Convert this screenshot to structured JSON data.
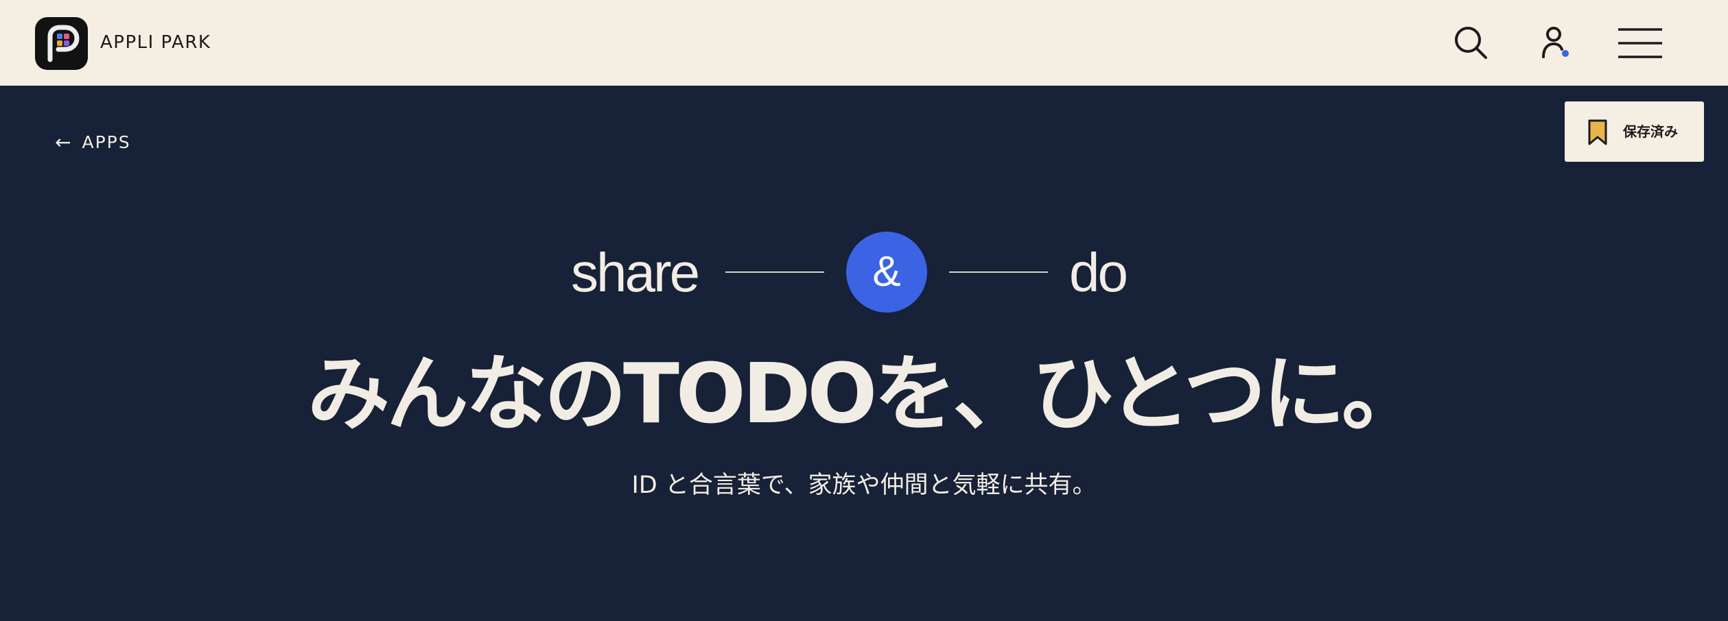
{
  "header": {
    "brand": "APPLI PARK",
    "icons": {
      "logo": "appli-park-logo",
      "search": "search-icon",
      "user": "user-icon",
      "menu": "hamburger-menu-icon"
    },
    "user_status_dot_color": "#3b63e4"
  },
  "nav": {
    "back_arrow": "←",
    "back_label": "APPS"
  },
  "saved_button": {
    "label": "保存済み",
    "icon": "bookmark-icon",
    "icon_color": "#e8b54a"
  },
  "hero": {
    "tagline": {
      "left_word": "share",
      "connector": "&",
      "right_word": "do"
    },
    "headline": "みんなのTODOを、ひとつに。",
    "subline": "ID と合言葉で、家族や仲間と気軽に共有。"
  },
  "colors": {
    "header_bg": "#f5eee3",
    "page_bg": "#172137",
    "accent": "#3b63e4",
    "text_light": "#f2ede4"
  }
}
